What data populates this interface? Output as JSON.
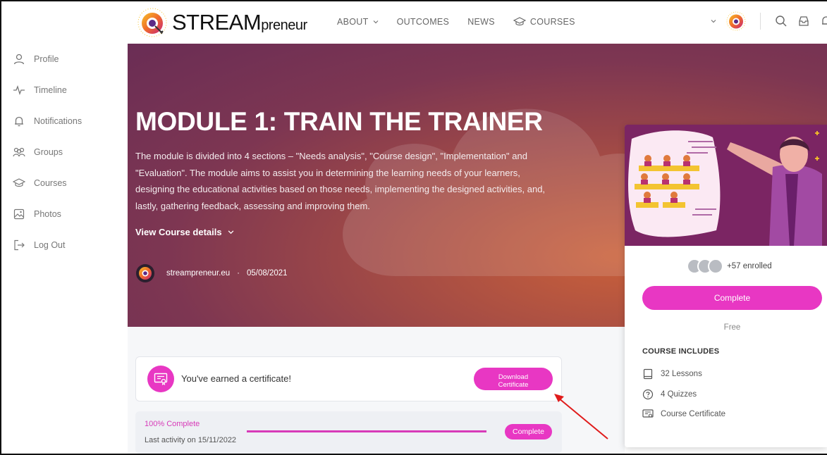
{
  "brand": {
    "name_main": "STREAM",
    "name_suffix": "preneur",
    "accent": "#e837c3"
  },
  "nav": {
    "items": [
      {
        "label": "ABOUT",
        "has_dropdown": true
      },
      {
        "label": "OUTCOMES",
        "has_dropdown": false
      },
      {
        "label": "NEWS",
        "has_dropdown": false
      },
      {
        "label": "COURSES",
        "icon": "graduation-cap-icon"
      }
    ]
  },
  "header_right": {
    "icons": [
      "chevron-down-icon",
      "avatar",
      "search-icon",
      "inbox-icon",
      "bell-icon"
    ]
  },
  "sidebar": {
    "items": [
      {
        "label": "Profile",
        "icon": "user-icon"
      },
      {
        "label": "Timeline",
        "icon": "activity-icon"
      },
      {
        "label": "Notifications",
        "icon": "bell-icon"
      },
      {
        "label": "Groups",
        "icon": "groups-icon"
      },
      {
        "label": "Courses",
        "icon": "graduation-cap-icon"
      },
      {
        "label": "Photos",
        "icon": "image-icon"
      },
      {
        "label": "Log Out",
        "icon": "logout-icon"
      }
    ]
  },
  "hero": {
    "title": "MODULE 1: TRAIN THE TRAINER",
    "description": "The module is divided into 4 sections – \"Needs analysis\", \"Course design\", \"Implementation\" and \"Evaluation\". The module aims to assist you in determining the learning needs of your learners, designing the educational activities based on those needs, implementing the designed activities, and, lastly, gathering feedback, assessing and improving them.",
    "details_label": "View Course details",
    "author": "streampreneur.eu",
    "date": "05/08/2021"
  },
  "certificate": {
    "message": "You've earned a certificate!",
    "button_line1": "Download",
    "button_line2": "Certificate"
  },
  "progress": {
    "percent_label": "100% Complete",
    "percent": 100,
    "last_activity": "Last activity on 15/11/2022",
    "button": "Complete"
  },
  "card": {
    "enrolled": "+57 enrolled",
    "button": "Complete",
    "price": "Free",
    "includes_title": "COURSE INCLUDES",
    "includes": [
      {
        "label": "32 Lessons",
        "icon": "book-icon"
      },
      {
        "label": "4 Quizzes",
        "icon": "question-icon"
      },
      {
        "label": "Course Certificate",
        "icon": "certificate-icon"
      }
    ]
  }
}
